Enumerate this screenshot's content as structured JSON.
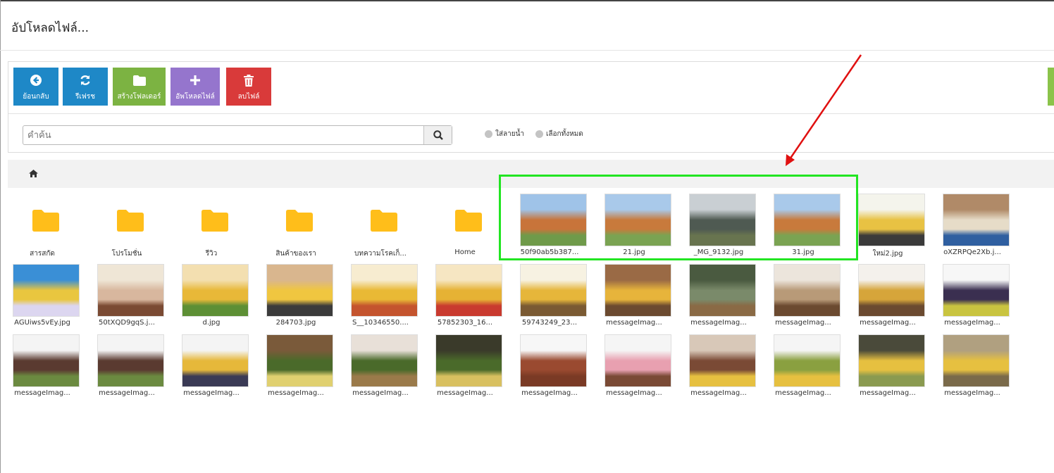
{
  "modal": {
    "title": "อัปโหลดไฟล์..."
  },
  "toolbar": {
    "buttons": [
      {
        "label": "ย้อนกลับ",
        "icon": "arrow-left-circle-icon",
        "color": "#1e88c7"
      },
      {
        "label": "รีเฟรช",
        "icon": "refresh-icon",
        "color": "#1e88c7"
      },
      {
        "label": "สร้างโฟลเดอร์",
        "icon": "folder-icon",
        "color": "#7cb342"
      },
      {
        "label": "อัพโหลดไฟล์",
        "icon": "plus-icon",
        "color": "#9575cd"
      },
      {
        "label": "ลบไฟล์",
        "icon": "trash-icon",
        "color": "#d93a3a"
      }
    ]
  },
  "search": {
    "placeholder": "คำค้น",
    "value": "",
    "button_icon": "search-icon"
  },
  "options": {
    "watermark_label": "ใส่ลายน้ำ",
    "select_all_label": "เลือกทั้งหมด"
  },
  "breadcrumb": {
    "home_icon": "home-icon"
  },
  "files": [
    {
      "name": "สารสกัด",
      "type": "folder"
    },
    {
      "name": "โปรโมชั่น",
      "type": "folder"
    },
    {
      "name": "รีวิว",
      "type": "folder"
    },
    {
      "name": "สินค้าของเรา",
      "type": "folder"
    },
    {
      "name": "บทความโรคเก็...",
      "type": "folder"
    },
    {
      "name": "Home",
      "type": "folder"
    },
    {
      "name": "50f90ab5b387...",
      "type": "image",
      "colors": [
        "#9fc3e8",
        "#c8743a",
        "#6f9a4a"
      ]
    },
    {
      "name": "21.jpg",
      "type": "image",
      "colors": [
        "#a9c9ea",
        "#c87a3c",
        "#7aa352"
      ]
    },
    {
      "name": "_MG_9132.jpg",
      "type": "image",
      "colors": [
        "#c9cfd3",
        "#4f5a52",
        "#68744f"
      ]
    },
    {
      "name": "31.jpg",
      "type": "image",
      "colors": [
        "#a9c9ea",
        "#c87a3c",
        "#7aa352"
      ]
    },
    {
      "name": "ใหม่2.jpg",
      "type": "image",
      "colors": [
        "#f4f4ec",
        "#e8c243",
        "#3a3a3a"
      ]
    },
    {
      "name": "oXZRPQe2Xb.j...",
      "type": "image",
      "colors": [
        "#b08a68",
        "#e6dcc8",
        "#2f5fa0"
      ]
    },
    {
      "name": "AGUiws5vEy.jpg",
      "type": "image",
      "colors": [
        "#3a8fd6",
        "#e9c63f",
        "#dcd6f0"
      ]
    },
    {
      "name": "50tXQD9gqS.j...",
      "type": "image",
      "colors": [
        "#efe6d6",
        "#d8b79e",
        "#7a4a33"
      ]
    },
    {
      "name": "d.jpg",
      "type": "image",
      "colors": [
        "#f3dfb0",
        "#e8b838",
        "#5d8f35"
      ]
    },
    {
      "name": "284703.jpg",
      "type": "image",
      "colors": [
        "#d9b68e",
        "#f0c640",
        "#3b3b3b"
      ]
    },
    {
      "name": "S__10346550....",
      "type": "image",
      "colors": [
        "#f7ecd0",
        "#e9b935",
        "#c4542e"
      ]
    },
    {
      "name": "57852303_16...",
      "type": "image",
      "colors": [
        "#f6e6c2",
        "#e6b234",
        "#c93a2f"
      ]
    },
    {
      "name": "59743249_23...",
      "type": "image",
      "colors": [
        "#f7f2e2",
        "#e6b63a",
        "#7a5a33"
      ]
    },
    {
      "name": "messageImag...",
      "type": "image",
      "colors": [
        "#9a6a45",
        "#e7b43b",
        "#6b4a30"
      ]
    },
    {
      "name": "messageImag...",
      "type": "image",
      "colors": [
        "#4a5a40",
        "#7a8a6a",
        "#8a6a45"
      ]
    },
    {
      "name": "messageImag...",
      "type": "image",
      "colors": [
        "#ece5dc",
        "#b89a78",
        "#6b4a30"
      ]
    },
    {
      "name": "messageImag...",
      "type": "image",
      "colors": [
        "#f4f1ec",
        "#d6a53a",
        "#6b4a30"
      ]
    },
    {
      "name": "messageImag...",
      "type": "image",
      "colors": [
        "#f7f7f7",
        "#3a2f50",
        "#c9c440"
      ]
    },
    {
      "name": "messageImag...",
      "type": "image",
      "colors": [
        "#f4f4f4",
        "#5a3a30",
        "#6b8a40"
      ]
    },
    {
      "name": "messageImag...",
      "type": "image",
      "colors": [
        "#f4f4f4",
        "#5a3a30",
        "#6b8a40"
      ]
    },
    {
      "name": "messageImag...",
      "type": "image",
      "colors": [
        "#f4f4f4",
        "#e6b83a",
        "#3a3a55"
      ]
    },
    {
      "name": "messageImag...",
      "type": "image",
      "colors": [
        "#7a5a3a",
        "#4a6a2a",
        "#e0d070"
      ]
    },
    {
      "name": "messageImag...",
      "type": "image",
      "colors": [
        "#e8e0d8",
        "#4a6a2a",
        "#9a7a4a"
      ]
    },
    {
      "name": "messageImag...",
      "type": "image",
      "colors": [
        "#3a3a2a",
        "#4a6a2a",
        "#d8c060"
      ]
    },
    {
      "name": "messageImag...",
      "type": "image",
      "colors": [
        "#f7f7f7",
        "#9a4a30",
        "#7a3a25"
      ]
    },
    {
      "name": "messageImag...",
      "type": "image",
      "colors": [
        "#f5f5f5",
        "#e8a0b0",
        "#7a4a35"
      ]
    },
    {
      "name": "messageImag...",
      "type": "image",
      "colors": [
        "#d8c8b8",
        "#7a4a35",
        "#e6c040"
      ]
    },
    {
      "name": "messageImag...",
      "type": "image",
      "colors": [
        "#f5f5f5",
        "#8aa040",
        "#e6c040"
      ]
    },
    {
      "name": "messageImag...",
      "type": "image",
      "colors": [
        "#4a4a3a",
        "#e6c040",
        "#8a9a50"
      ]
    },
    {
      "name": "messageImag...",
      "type": "image",
      "colors": [
        "#b0a080",
        "#e6c040",
        "#7a6a4a"
      ]
    }
  ],
  "annotation": {
    "box_color": "#22e522",
    "arrow_color": "#e01010"
  }
}
